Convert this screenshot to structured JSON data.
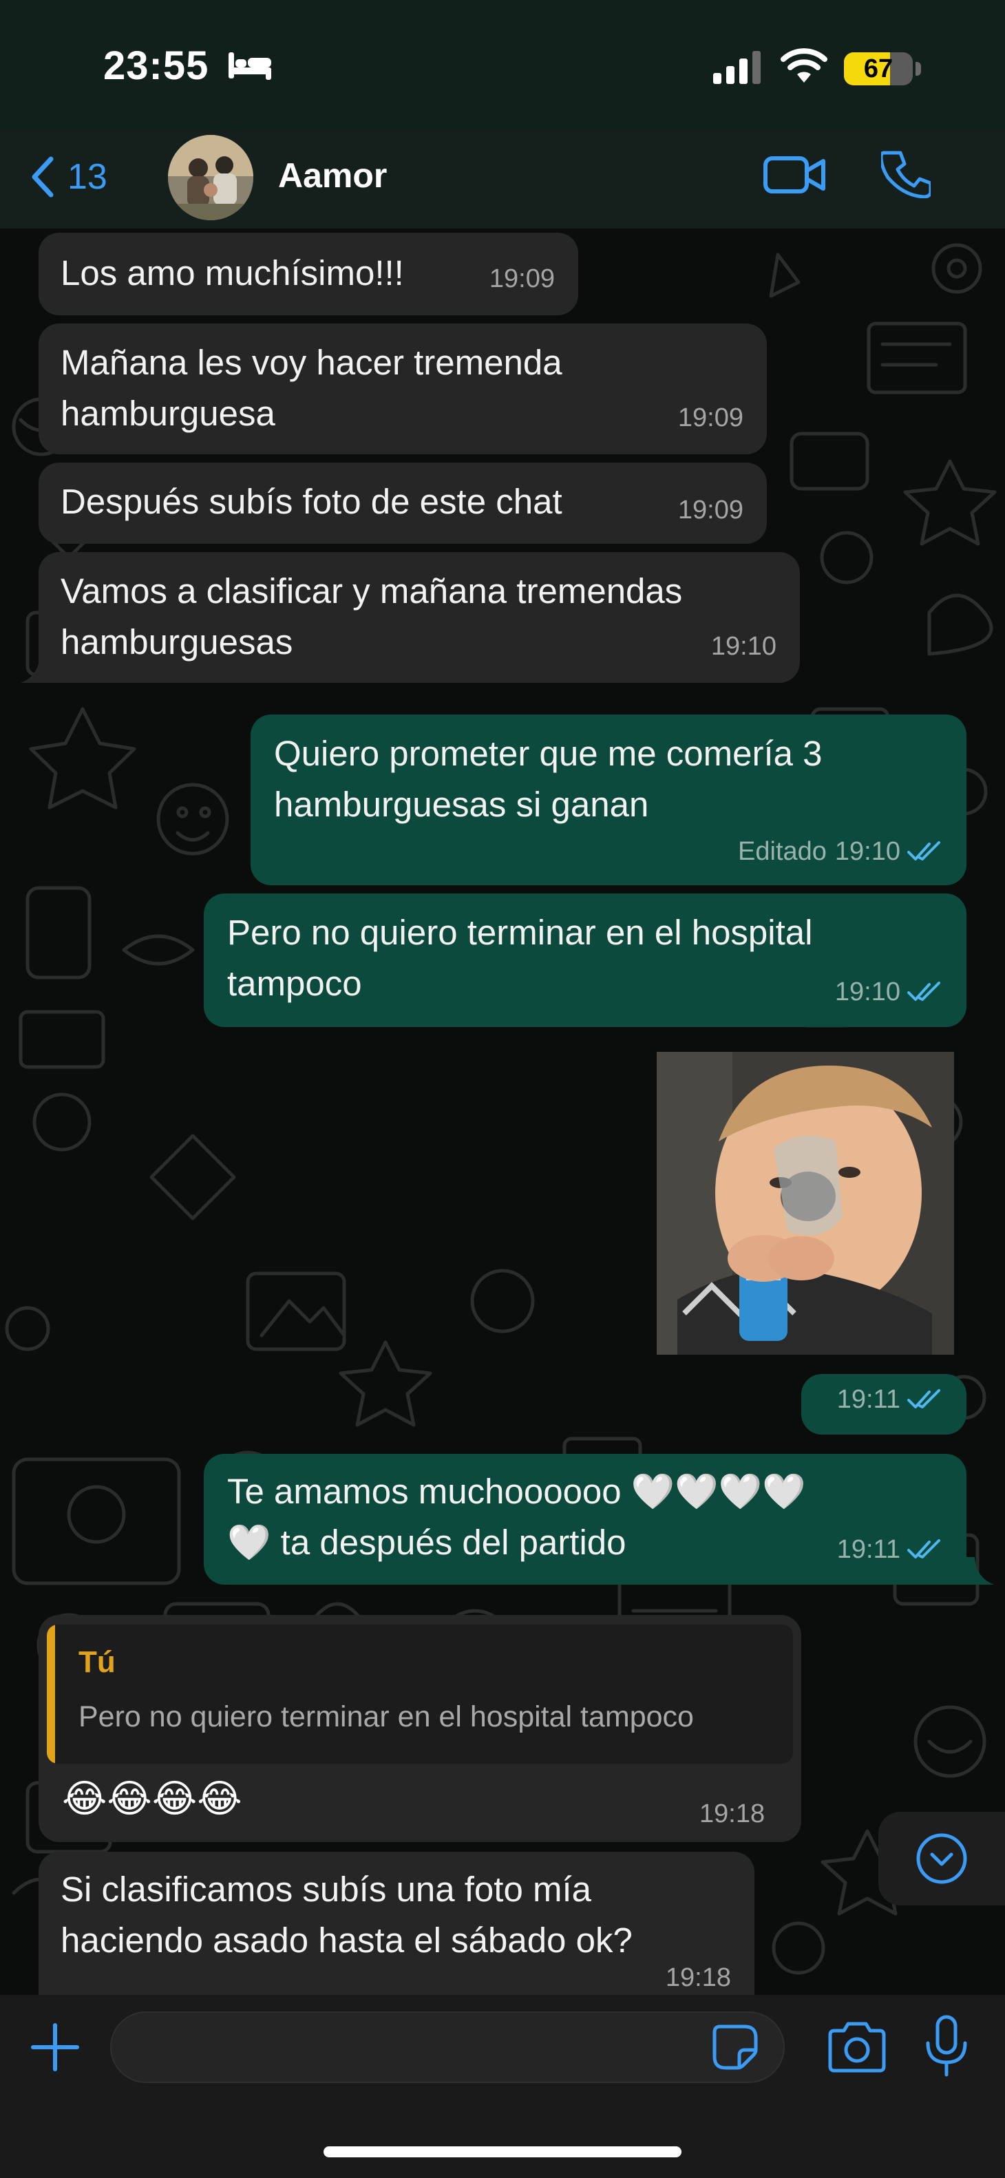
{
  "status_bar": {
    "time": "23:55",
    "battery": "67",
    "battery_level": 0.67
  },
  "header": {
    "back_count": "13",
    "contact_name": "Aamor"
  },
  "colors": {
    "accent": "#3b9cf5",
    "incoming_bubble": "#262626",
    "outgoing_bubble": "#0c4a3d",
    "read_ticks": "#4fb6f0",
    "reply_author": "#e0a31a",
    "battery": "#f5d90a"
  },
  "messages": [
    {
      "dir": "in",
      "lines": [
        "Los amo muchísimo!!!"
      ],
      "time": "19:09"
    },
    {
      "dir": "in",
      "lines": [
        "Mañana les voy hacer tremenda",
        "hamburguesa"
      ],
      "time": "19:09"
    },
    {
      "dir": "in",
      "lines": [
        "Después subís foto de este chat"
      ],
      "time": "19:09"
    },
    {
      "dir": "in",
      "lines": [
        "Vamos a clasificar y mañana tremendas",
        "hamburguesas"
      ],
      "time": "19:10"
    },
    {
      "dir": "out",
      "lines": [
        "Quiero prometer que me comería 3",
        "hamburguesas si ganan"
      ],
      "edited": "Editado",
      "time": "19:10"
    },
    {
      "dir": "out",
      "lines": [
        "Pero no quiero terminar en el hospital",
        "tampoco"
      ],
      "time": "19:10"
    },
    {
      "dir": "out",
      "type": "photo",
      "time": "19:11"
    },
    {
      "dir": "out",
      "lines": [
        "Te amamos muchoooooo 🤍🤍🤍🤍",
        "🤍 ta después del partido"
      ],
      "time": "19:11"
    },
    {
      "dir": "in",
      "reply_to": {
        "author": "Tú",
        "text": "Pero no quiero terminar en el hospital tampoco"
      },
      "lines": [
        "😂😂😂😂"
      ],
      "time": "19:18"
    },
    {
      "dir": "in",
      "lines": [
        "Si clasificamos subís una foto mía",
        "haciendo asado hasta el sábado ok?"
      ],
      "time": "19:18"
    }
  ],
  "icons": [
    "bed-icon",
    "signal-icon",
    "wifi-icon",
    "back-chevron-icon",
    "video-call-icon",
    "phone-icon",
    "read-ticks-icon",
    "chevron-down-icon",
    "plus-icon",
    "sticker-icon",
    "camera-icon",
    "microphone-icon"
  ]
}
